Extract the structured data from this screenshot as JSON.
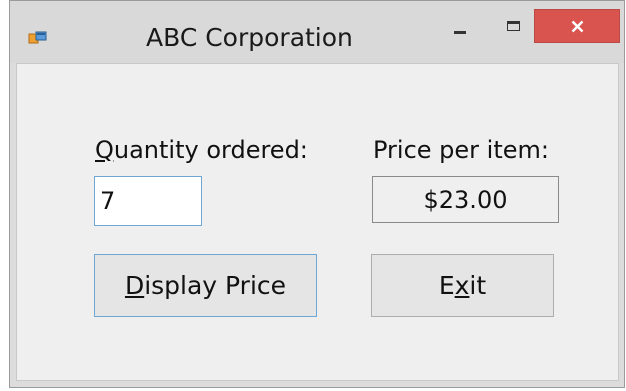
{
  "window": {
    "title": "ABC Corporation",
    "close_color": "#d9534f",
    "icons": [
      "app-icon",
      "minimize-icon",
      "maximize-icon",
      "close-icon"
    ]
  },
  "form": {
    "quantity_label": "Quantity ordered:",
    "quantity_value": "7",
    "price_label": "Price per item:",
    "price_value": "$23.00",
    "display_button": {
      "label": "Display Price"
    },
    "exit_button": {
      "label": "Exit"
    }
  }
}
